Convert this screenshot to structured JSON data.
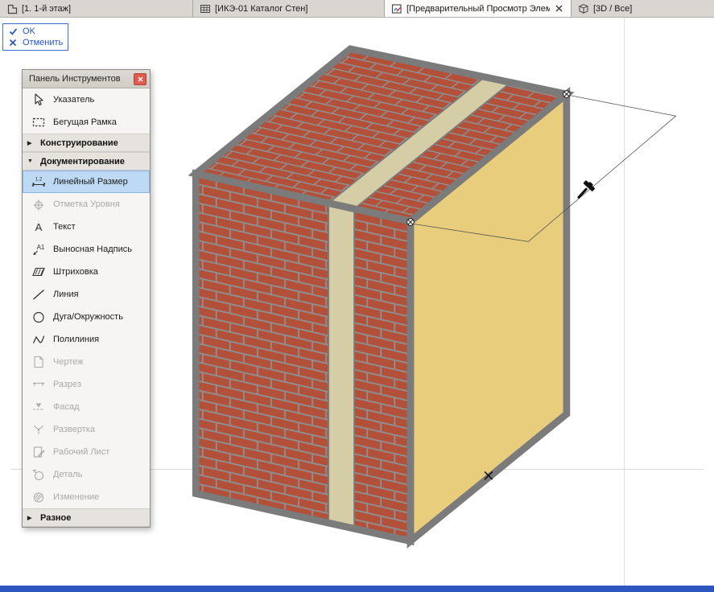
{
  "tab_bar": {
    "tabs": [
      {
        "label": "[1. 1-й этаж]",
        "active": false
      },
      {
        "label": "[ИКЭ-01 Каталог Стен]",
        "active": false
      },
      {
        "label": "[Предварительный Просмотр Элем…",
        "active": true,
        "closable": true
      },
      {
        "label": "[3D / Все]",
        "active": false
      }
    ]
  },
  "confirm": {
    "ok_label": "OK",
    "cancel_label": "Отменить"
  },
  "tool_panel": {
    "title": "Панель Инструментов",
    "items": [
      {
        "type": "tool",
        "label": "Указатель",
        "enabled": true
      },
      {
        "type": "tool",
        "label": "Бегущая Рамка",
        "enabled": true
      },
      {
        "type": "section",
        "label": "Конструирование",
        "expanded": false
      },
      {
        "type": "section",
        "label": "Документирование",
        "expanded": true
      },
      {
        "type": "tool",
        "label": "Линейный Размер",
        "enabled": true,
        "selected": true
      },
      {
        "type": "tool",
        "label": "Отметка Уровня",
        "enabled": false
      },
      {
        "type": "tool",
        "label": "Текст",
        "enabled": true
      },
      {
        "type": "tool",
        "label": "Выносная Надпись",
        "enabled": true
      },
      {
        "type": "tool",
        "label": "Штриховка",
        "enabled": true
      },
      {
        "type": "tool",
        "label": "Линия",
        "enabled": true
      },
      {
        "type": "tool",
        "label": "Дуга/Окружность",
        "enabled": true
      },
      {
        "type": "tool",
        "label": "Полилиния",
        "enabled": true
      },
      {
        "type": "tool",
        "label": "Чертеж",
        "enabled": false
      },
      {
        "type": "tool",
        "label": "Разрез",
        "enabled": false
      },
      {
        "type": "tool",
        "label": "Фасад",
        "enabled": false
      },
      {
        "type": "tool",
        "label": "Развертка",
        "enabled": false
      },
      {
        "type": "tool",
        "label": "Рабочий Лист",
        "enabled": false
      },
      {
        "type": "tool",
        "label": "Деталь",
        "enabled": false
      },
      {
        "type": "tool",
        "label": "Изменение",
        "enabled": false
      },
      {
        "type": "section",
        "label": "Разное",
        "expanded": false
      }
    ]
  },
  "icons": {
    "collapsed": "▶",
    "expanded": "▼"
  },
  "colors": {
    "accent_blue": "#2456c8",
    "selection_fill": "#bdd9f3",
    "brick_red": "#b2503a",
    "mortar_gray": "#8f8f8f",
    "insulation_beige": "#d5cda6",
    "wall_face_yellow": "#e8cd7c",
    "edge_gray": "#7b7b7b",
    "panel_close_red": "#e15a4d"
  }
}
